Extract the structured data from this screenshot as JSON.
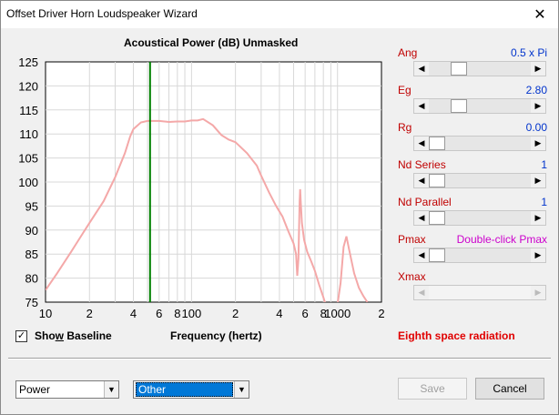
{
  "window": {
    "title": "Offset Driver Horn Loudspeaker Wizard",
    "close_glyph": "✕"
  },
  "chart_data": {
    "type": "line",
    "title": "Acoustical Power (dB)   Unmasked",
    "xlabel": "Frequency (hertz)",
    "ylabel": "",
    "xscale": "log",
    "xlim": [
      10,
      2000
    ],
    "ylim": [
      75,
      125
    ],
    "yticks": [
      75,
      80,
      85,
      90,
      95,
      100,
      105,
      110,
      115,
      120,
      125
    ],
    "xtick_labels": [
      {
        "x": 10,
        "label": "10"
      },
      {
        "x": 20,
        "label": "2"
      },
      {
        "x": 40,
        "label": "4"
      },
      {
        "x": 60,
        "label": "6"
      },
      {
        "x": 80,
        "label": "8"
      },
      {
        "x": 100,
        "label": "100"
      },
      {
        "x": 200,
        "label": "2"
      },
      {
        "x": 400,
        "label": "4"
      },
      {
        "x": 600,
        "label": "6"
      },
      {
        "x": 800,
        "label": "8"
      },
      {
        "x": 1000,
        "label": "1000"
      },
      {
        "x": 2000,
        "label": "2"
      }
    ],
    "grid": true,
    "marker_line": {
      "x": 52,
      "color": "#008000"
    },
    "series": [
      {
        "color": "#f4a8a8",
        "x": [
          10,
          12,
          15,
          18,
          20,
          25,
          30,
          35,
          38,
          40,
          45,
          50,
          60,
          70,
          80,
          90,
          100,
          110,
          120,
          140,
          160,
          180,
          200,
          240,
          280,
          300,
          340,
          380,
          420,
          460,
          500,
          520,
          530,
          540,
          550,
          555,
          560,
          570,
          590,
          620,
          660,
          700,
          750,
          800,
          830,
          850,
          870,
          900,
          950,
          1000,
          1050,
          1100,
          1150,
          1200,
          1300,
          1400,
          1500,
          1600
        ],
        "y": [
          77.5,
          81,
          85.5,
          89.3,
          91.5,
          96,
          101,
          106,
          109.5,
          111,
          112.4,
          112.7,
          112.7,
          112.5,
          112.6,
          112.6,
          112.8,
          112.8,
          113.1,
          111.8,
          109.8,
          108.8,
          108.3,
          106,
          103.4,
          101.3,
          97.8,
          95,
          92.8,
          89.8,
          87.2,
          85,
          80.5,
          84,
          96,
          98.5,
          96,
          91.5,
          88,
          85.5,
          83.5,
          81.5,
          78.5,
          76,
          74.5,
          72.5,
          71,
          70.5,
          71.5,
          74.5,
          79,
          86.5,
          88.7,
          86,
          81,
          78,
          76.3,
          75
        ]
      }
    ]
  },
  "show_baseline": {
    "label_pre": "Sho",
    "label_u": "w",
    "label_post": " Baseline",
    "checked_glyph": "✓"
  },
  "sliders": [
    {
      "label": "Ang",
      "value": "0.5 x Pi",
      "pos": 0.25,
      "value_color": "#0033cc",
      "disabled": false
    },
    {
      "label": "Eg",
      "value": "2.80",
      "pos": 0.25,
      "value_color": "#0033cc",
      "disabled": false
    },
    {
      "label": "Rg",
      "value": "0.00",
      "pos": 0.0,
      "value_color": "#0033cc",
      "disabled": false
    },
    {
      "label": "Nd  Series",
      "value": "1",
      "pos": 0.0,
      "value_color": "#0033cc",
      "disabled": false
    },
    {
      "label": "Nd  Parallel",
      "value": "1",
      "pos": 0.0,
      "value_color": "#0033cc",
      "disabled": false
    },
    {
      "label": "Pmax",
      "value": "Double-click Pmax",
      "pos": 0.0,
      "value_color": "#cc00cc",
      "disabled": false
    },
    {
      "label": "Xmax",
      "value": "",
      "pos": null,
      "value_color": "#0033cc",
      "disabled": true
    }
  ],
  "radiation_label": "Eighth space radiation",
  "bottom": {
    "plot_select": "Power",
    "driver_select": "Other",
    "save_label": "Save",
    "cancel_label": "Cancel"
  },
  "glyphs": {
    "left": "◀",
    "right": "▶",
    "down": "▼"
  }
}
